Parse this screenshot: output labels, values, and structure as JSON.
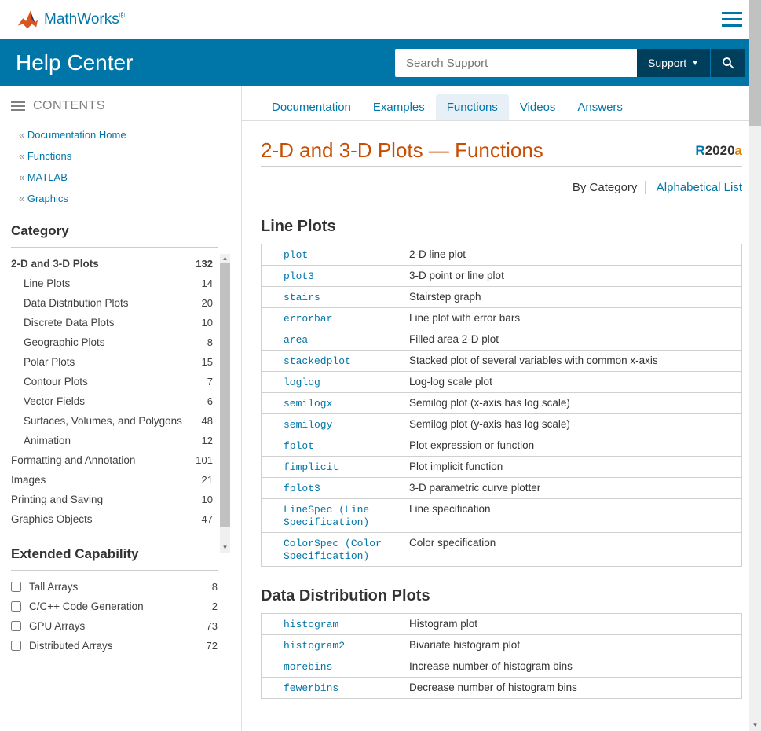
{
  "brand": "MathWorks",
  "help_center": "Help Center",
  "search_placeholder": "Search Support",
  "support_label": "Support",
  "contents_label": "CONTENTS",
  "breadcrumbs": [
    "Documentation Home",
    "Functions",
    "MATLAB",
    "Graphics"
  ],
  "category_heading": "Category",
  "categories": [
    {
      "label": "2-D and 3-D Plots",
      "count": "132",
      "active": true,
      "sub": false
    },
    {
      "label": "Line Plots",
      "count": "14",
      "sub": true
    },
    {
      "label": "Data Distribution Plots",
      "count": "20",
      "sub": true
    },
    {
      "label": "Discrete Data Plots",
      "count": "10",
      "sub": true
    },
    {
      "label": "Geographic Plots",
      "count": "8",
      "sub": true
    },
    {
      "label": "Polar Plots",
      "count": "15",
      "sub": true
    },
    {
      "label": "Contour Plots",
      "count": "7",
      "sub": true
    },
    {
      "label": "Vector Fields",
      "count": "6",
      "sub": true
    },
    {
      "label": "Surfaces, Volumes, and Polygons",
      "count": "48",
      "sub": true
    },
    {
      "label": "Animation",
      "count": "12",
      "sub": true
    },
    {
      "label": "Formatting and Annotation",
      "count": "101",
      "sub": false
    },
    {
      "label": "Images",
      "count": "21",
      "sub": false
    },
    {
      "label": "Printing and Saving",
      "count": "10",
      "sub": false
    },
    {
      "label": "Graphics Objects",
      "count": "47",
      "sub": false
    }
  ],
  "extended_heading": "Extended Capability",
  "extended": [
    {
      "label": "Tall Arrays",
      "count": "8"
    },
    {
      "label": "C/C++ Code Generation",
      "count": "2"
    },
    {
      "label": "GPU Arrays",
      "count": "73"
    },
    {
      "label": "Distributed Arrays",
      "count": "72"
    }
  ],
  "tabs": [
    "Documentation",
    "Examples",
    "Functions",
    "Videos",
    "Answers"
  ],
  "active_tab": "Functions",
  "page_title": "2-D and 3-D Plots — Functions",
  "release": {
    "r": "R",
    "y": "2020",
    "a": "a"
  },
  "view": {
    "current": "By Category",
    "other": "Alphabetical List"
  },
  "sections": [
    {
      "title": "Line Plots",
      "rows": [
        {
          "fn": "plot",
          "desc": "2-D line plot"
        },
        {
          "fn": "plot3",
          "desc": "3-D point or line plot"
        },
        {
          "fn": "stairs",
          "desc": "Stairstep graph"
        },
        {
          "fn": "errorbar",
          "desc": "Line plot with error bars"
        },
        {
          "fn": "area",
          "desc": "Filled area 2-D plot"
        },
        {
          "fn": "stackedplot",
          "desc": "Stacked plot of several variables with common x-axis"
        },
        {
          "fn": "loglog",
          "desc": "Log-log scale plot"
        },
        {
          "fn": "semilogx",
          "desc": "Semilog plot (x-axis has log scale)"
        },
        {
          "fn": "semilogy",
          "desc": "Semilog plot (y-axis has log scale)"
        },
        {
          "fn": "fplot",
          "desc": "Plot expression or function"
        },
        {
          "fn": "fimplicit",
          "desc": "Plot implicit function"
        },
        {
          "fn": "fplot3",
          "desc": "3-D parametric curve plotter"
        },
        {
          "fn": "LineSpec (Line Specification)",
          "desc": "Line specification"
        },
        {
          "fn": "ColorSpec (Color Specification)",
          "desc": "Color specification"
        }
      ]
    },
    {
      "title": "Data Distribution Plots",
      "rows": [
        {
          "fn": "histogram",
          "desc": "Histogram plot"
        },
        {
          "fn": "histogram2",
          "desc": "Bivariate histogram plot"
        },
        {
          "fn": "morebins",
          "desc": "Increase number of histogram bins"
        },
        {
          "fn": "fewerbins",
          "desc": "Decrease number of histogram bins"
        }
      ]
    }
  ]
}
